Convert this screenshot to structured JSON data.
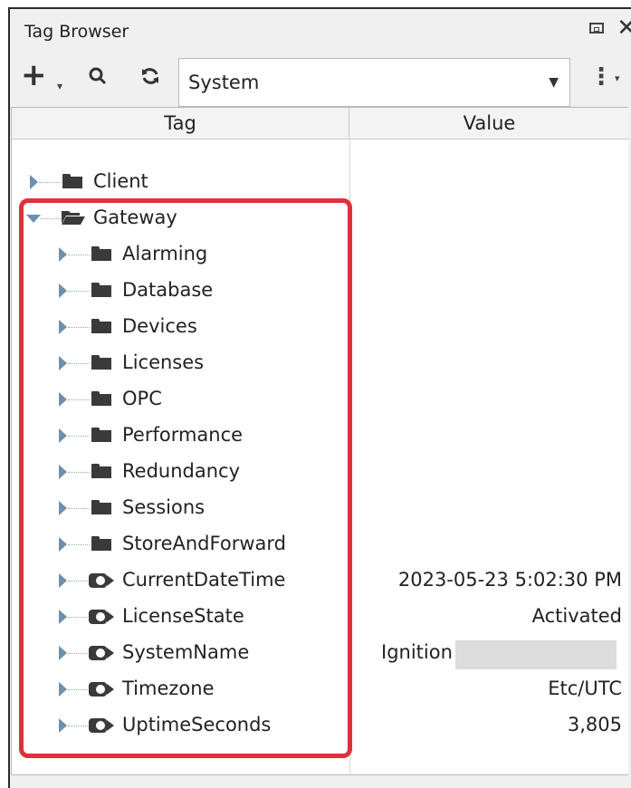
{
  "window": {
    "title": "Tag Browser"
  },
  "toolbar": {
    "provider_value": "System",
    "icons": [
      "plus-icon",
      "caret-icon",
      "search-icon",
      "refresh-icon",
      "kebab-icon"
    ]
  },
  "columns": {
    "tag": "Tag",
    "value": "Value"
  },
  "tree": {
    "client": "Client",
    "gateway": "Gateway",
    "folders": [
      "Alarming",
      "Database",
      "Devices",
      "Licenses",
      "OPC",
      "Performance",
      "Redundancy",
      "Sessions",
      "StoreAndForward"
    ],
    "tags": [
      {
        "name": "CurrentDateTime",
        "value": "2023-05-23 5:02:30 PM"
      },
      {
        "name": "LicenseState",
        "value": "Activated"
      },
      {
        "name": "SystemName",
        "value": "Ignition"
      },
      {
        "name": "Timezone",
        "value": "Etc/UTC"
      },
      {
        "name": "UptimeSeconds",
        "value": "3,805"
      }
    ]
  },
  "colors": {
    "highlight": "#e0303a",
    "expander": "#6f8fae"
  }
}
